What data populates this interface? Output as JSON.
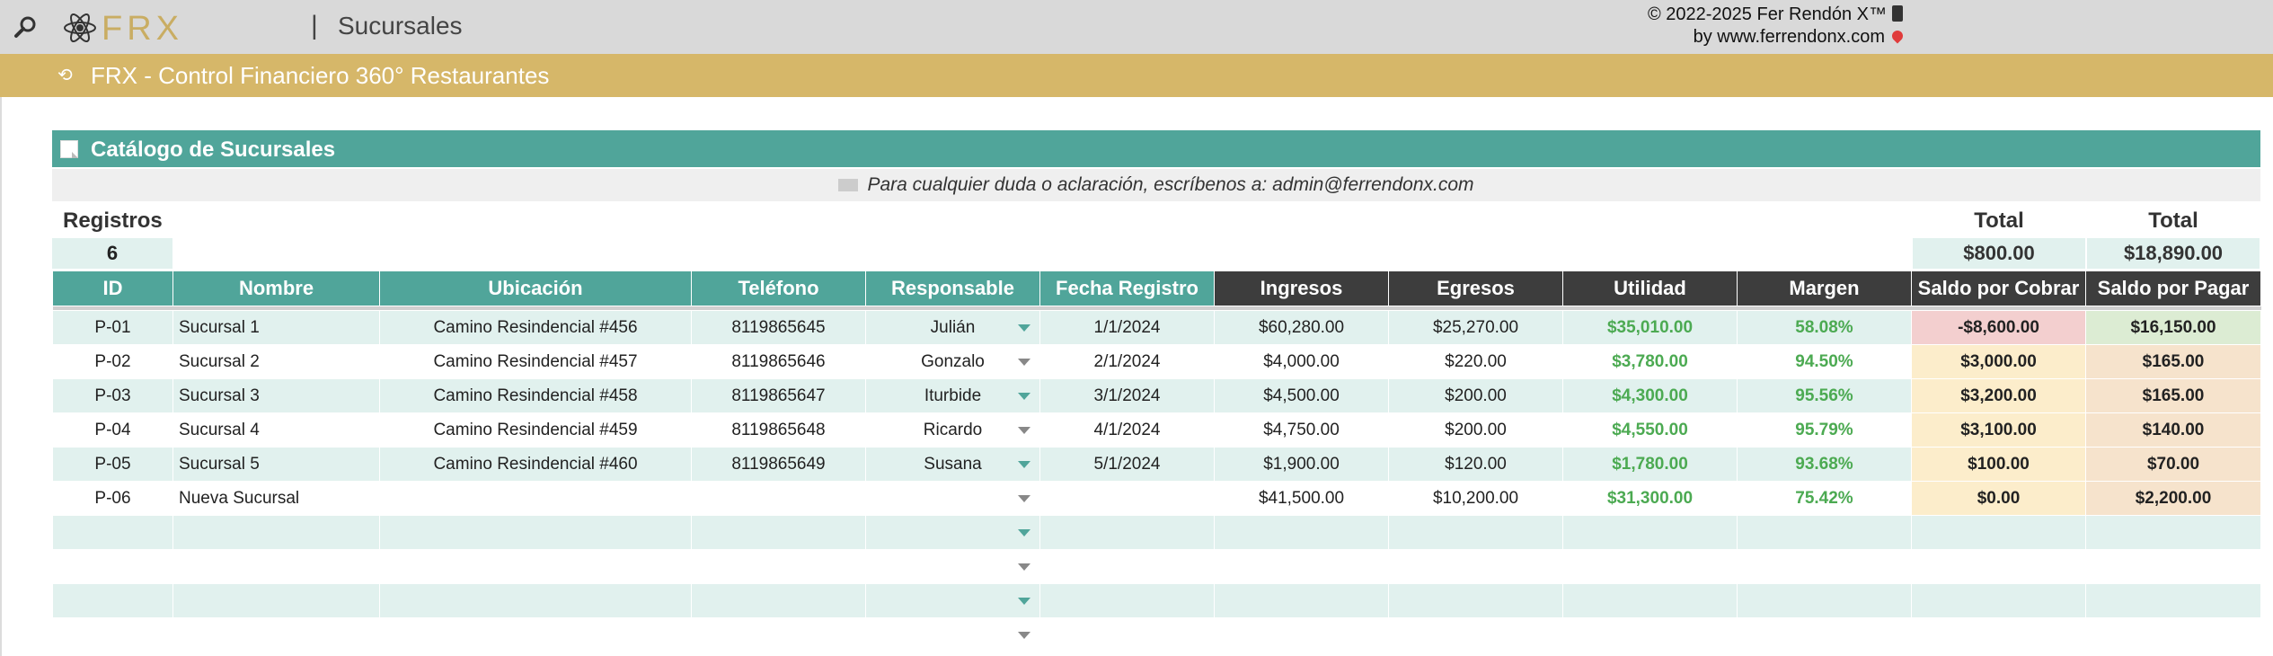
{
  "app": {
    "page_title": "Sucursales",
    "logo_text": "FRX",
    "separator": "|",
    "credit_line1": "© 2022-2025 Fer Rendón X™",
    "credit_line2": "by www.ferrendonx.com",
    "banner_text": "FRX - Control Financiero 360° Restaurantes"
  },
  "section": {
    "title": "Catálogo de Sucursales",
    "contact": "Para cualquier duda o aclaración, escríbenos a: admin@ferrendonx.com"
  },
  "summary": {
    "registros_label": "Registros",
    "registros_value": "6",
    "total_label": "Total",
    "total_cobrar": "$800.00",
    "total_pagar": "$18,890.00"
  },
  "columns": [
    "ID",
    "Nombre",
    "Ubicación",
    "Teléfono",
    "Responsable",
    "Fecha Registro",
    "Ingresos",
    "Egresos",
    "Utilidad",
    "Margen",
    "Saldo por Cobrar",
    "Saldo por Pagar"
  ],
  "rows": [
    {
      "id": "P-01",
      "nombre": "Sucursal 1",
      "ubicacion": "Camino Resindencial #456",
      "telefono": "8119865645",
      "responsable": "Julián",
      "fecha": "1/1/2024",
      "ingresos": "$60,280.00",
      "egresos": "$25,270.00",
      "utilidad": "$35,010.00",
      "margen": "58.08%",
      "cobrar": "-$8,600.00",
      "pagar": "$16,150.00"
    },
    {
      "id": "P-02",
      "nombre": "Sucursal 2",
      "ubicacion": "Camino Resindencial #457",
      "telefono": "8119865646",
      "responsable": "Gonzalo",
      "fecha": "2/1/2024",
      "ingresos": "$4,000.00",
      "egresos": "$220.00",
      "utilidad": "$3,780.00",
      "margen": "94.50%",
      "cobrar": "$3,000.00",
      "pagar": "$165.00"
    },
    {
      "id": "P-03",
      "nombre": "Sucursal 3",
      "ubicacion": "Camino Resindencial #458",
      "telefono": "8119865647",
      "responsable": "Iturbide",
      "fecha": "3/1/2024",
      "ingresos": "$4,500.00",
      "egresos": "$200.00",
      "utilidad": "$4,300.00",
      "margen": "95.56%",
      "cobrar": "$3,200.00",
      "pagar": "$165.00"
    },
    {
      "id": "P-04",
      "nombre": "Sucursal 4",
      "ubicacion": "Camino Resindencial #459",
      "telefono": "8119865648",
      "responsable": "Ricardo",
      "fecha": "4/1/2024",
      "ingresos": "$4,750.00",
      "egresos": "$200.00",
      "utilidad": "$4,550.00",
      "margen": "95.79%",
      "cobrar": "$3,100.00",
      "pagar": "$140.00"
    },
    {
      "id": "P-05",
      "nombre": "Sucursal 5",
      "ubicacion": "Camino Resindencial #460",
      "telefono": "8119865649",
      "responsable": "Susana",
      "fecha": "5/1/2024",
      "ingresos": "$1,900.00",
      "egresos": "$120.00",
      "utilidad": "$1,780.00",
      "margen": "93.68%",
      "cobrar": "$100.00",
      "pagar": "$70.00"
    },
    {
      "id": "P-06",
      "nombre": "Nueva Sucursal",
      "ubicacion": "",
      "telefono": "",
      "responsable": "",
      "fecha": "",
      "ingresos": "$41,500.00",
      "egresos": "$10,200.00",
      "utilidad": "$31,300.00",
      "margen": "75.42%",
      "cobrar": "$0.00",
      "pagar": "$2,200.00"
    }
  ],
  "empty_rows": 4,
  "colors": {
    "teal": "#50a59a",
    "gold": "#d6b769",
    "dark_header": "#3d3d3d",
    "green_text": "#4caa52"
  }
}
